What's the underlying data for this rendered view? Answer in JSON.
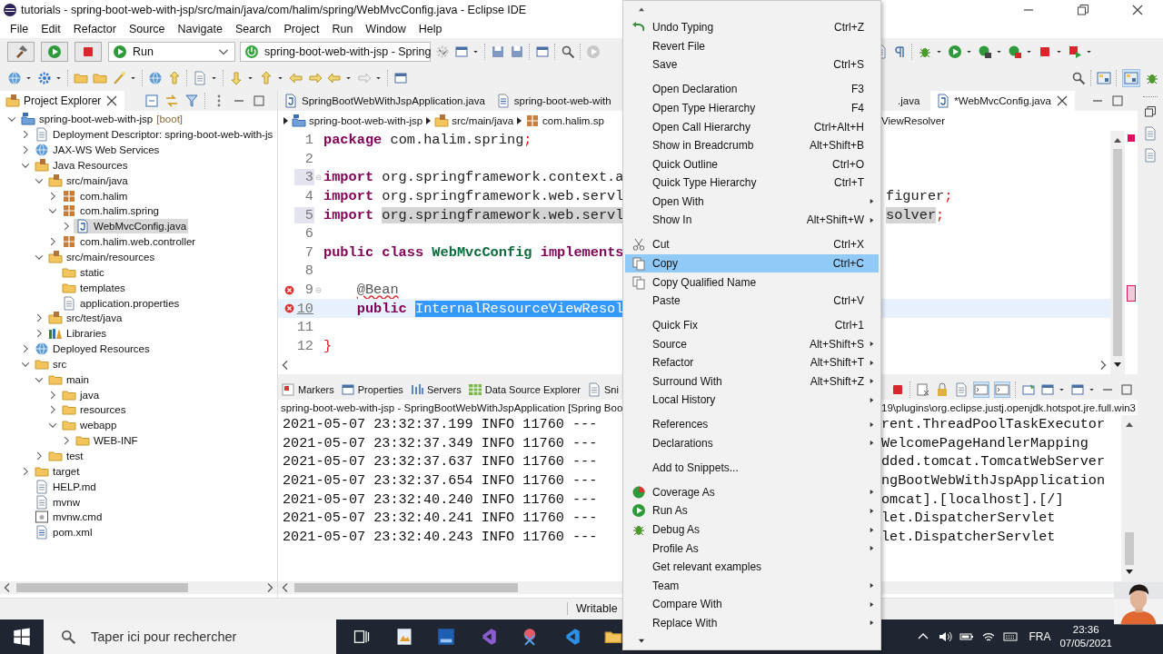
{
  "window": {
    "title": "tutorials - spring-boot-web-with-jsp/src/main/java/com/halim/spring/WebMvcConfig.java - Eclipse IDE"
  },
  "menu_bar": [
    "File",
    "Edit",
    "Refactor",
    "Source",
    "Navigate",
    "Search",
    "Project",
    "Run",
    "Window",
    "Help"
  ],
  "toolbar": {
    "run_combo": "Run",
    "launch_combo": "spring-boot-web-with-jsp - Spring"
  },
  "project_explorer": {
    "title": "Project Explorer",
    "tree": [
      {
        "label": "spring-boot-web-with-jsp",
        "tag": "[boot]",
        "kind": "project",
        "expanded": true,
        "selected": false,
        "children": [
          {
            "label": "Deployment Descriptor: spring-boot-web-with-js",
            "kind": "descriptor",
            "expanded": false,
            "selected": false
          },
          {
            "label": "JAX-WS Web Services",
            "kind": "services",
            "expanded": false,
            "selected": false
          },
          {
            "label": "Java Resources",
            "kind": "resources",
            "expanded": true,
            "selected": false,
            "children": [
              {
                "label": "src/main/java",
                "kind": "source-folder",
                "expanded": true,
                "selected": false,
                "children": [
                  {
                    "label": "com.halim",
                    "kind": "package",
                    "expanded": false,
                    "selected": false
                  },
                  {
                    "label": "com.halim.spring",
                    "kind": "package",
                    "expanded": true,
                    "selected": false,
                    "children": [
                      {
                        "label": "WebMvcConfig.java",
                        "kind": "java",
                        "expanded": false,
                        "selected": true
                      }
                    ]
                  },
                  {
                    "label": "com.halim.web.controller",
                    "kind": "package",
                    "expanded": false,
                    "selected": false
                  }
                ]
              },
              {
                "label": "src/main/resources",
                "kind": "source-folder",
                "expanded": true,
                "selected": false,
                "children": [
                  {
                    "label": "static",
                    "kind": "folder",
                    "selected": false
                  },
                  {
                    "label": "templates",
                    "kind": "folder",
                    "selected": false
                  },
                  {
                    "label": "application.properties",
                    "kind": "properties",
                    "selected": false
                  }
                ]
              },
              {
                "label": "src/test/java",
                "kind": "source-folder",
                "expanded": false,
                "selected": false
              },
              {
                "label": "Libraries",
                "kind": "library",
                "expanded": false,
                "selected": false
              }
            ]
          },
          {
            "label": "Deployed Resources",
            "kind": "deployed",
            "expanded": false,
            "selected": false
          },
          {
            "label": "src",
            "kind": "folder",
            "expanded": true,
            "selected": false,
            "children": [
              {
                "label": "main",
                "kind": "folder",
                "expanded": true,
                "selected": false,
                "children": [
                  {
                    "label": "java",
                    "kind": "folder",
                    "expanded": false,
                    "selected": false
                  },
                  {
                    "label": "resources",
                    "kind": "folder",
                    "expanded": false,
                    "selected": false
                  },
                  {
                    "label": "webapp",
                    "kind": "folder",
                    "expanded": true,
                    "selected": false,
                    "children": [
                      {
                        "label": "WEB-INF",
                        "kind": "folder",
                        "expanded": false,
                        "selected": false
                      }
                    ]
                  }
                ]
              },
              {
                "label": "test",
                "kind": "folder",
                "expanded": false,
                "selected": false
              }
            ]
          },
          {
            "label": "target",
            "kind": "folder",
            "expanded": false,
            "selected": false
          },
          {
            "label": "HELP.md",
            "kind": "document",
            "selected": false
          },
          {
            "label": "mvnw",
            "kind": "text",
            "selected": false
          },
          {
            "label": "mvnw.cmd",
            "kind": "command",
            "selected": false
          },
          {
            "label": "pom.xml",
            "kind": "xml",
            "selected": false
          }
        ]
      }
    ]
  },
  "editor": {
    "tabs": [
      {
        "label": "SpringBootWebWithJspApplication.java",
        "selected": false
      },
      {
        "label": "spring-boot-web-with",
        "selected": false
      }
    ],
    "tabs_past_menu": [
      {
        "label": ".java",
        "selected": false,
        "closable": false
      },
      {
        "label": "*WebMvcConfig.java",
        "selected": true,
        "closable": true
      }
    ],
    "breadcrumb": [
      "spring-boot-web-with-jsp",
      "src/main/java",
      "com.halim.sp"
    ],
    "breadcrumb_past_menu": "ViewResolver",
    "lines": [
      {
        "number": "1",
        "error": false,
        "fold": false,
        "marked": false,
        "current": false,
        "tokens": [
          {
            "text": "package",
            "kind": "keyword"
          },
          {
            "text": " com.halim.spring",
            "kind": "plain"
          },
          {
            "text": ";",
            "kind": "punct"
          }
        ]
      },
      {
        "number": "2",
        "error": false,
        "fold": false,
        "marked": false,
        "current": false
      },
      {
        "number": "3",
        "error": false,
        "fold": true,
        "marked": true,
        "current": false,
        "tokens": [
          {
            "text": "import",
            "kind": "keyword"
          },
          {
            "text": " org.springframework.context.a",
            "kind": "plain"
          }
        ]
      },
      {
        "number": "4",
        "error": false,
        "fold": false,
        "marked": false,
        "current": false,
        "tokens": [
          {
            "text": "import",
            "kind": "keyword"
          },
          {
            "text": " org.springframework.web.servl",
            "kind": "plain"
          }
        ],
        "after": [
          {
            "text": "figurer",
            "kind": "plain"
          },
          {
            "text": ";",
            "kind": "punct"
          }
        ]
      },
      {
        "number": "5",
        "error": false,
        "fold": false,
        "marked": true,
        "current": false,
        "tokens": [
          {
            "text": "import",
            "kind": "keyword"
          },
          {
            "text": " org.springframework.web.servl",
            "kind": "occurrence"
          }
        ],
        "after": [
          {
            "text": "solver",
            "kind": "occurrence"
          },
          {
            "text": ";",
            "kind": "punct"
          }
        ]
      },
      {
        "number": "6",
        "error": false,
        "fold": false,
        "marked": false,
        "current": false
      },
      {
        "number": "7",
        "error": false,
        "fold": false,
        "marked": false,
        "current": false,
        "tokens": [
          {
            "text": "public",
            "kind": "keyword"
          },
          {
            "text": " class",
            "kind": "keyword"
          },
          {
            "text": " WebMvcConfig",
            "kind": "type"
          },
          {
            "text": " implements",
            "kind": "keyword"
          }
        ]
      },
      {
        "number": "8",
        "error": false,
        "fold": false,
        "marked": false,
        "current": false
      },
      {
        "number": "9",
        "error": true,
        "fold": true,
        "marked": false,
        "current": false,
        "tokens": [
          {
            "text": "    @Bean",
            "kind": "annotation"
          }
        ]
      },
      {
        "number": "10",
        "error": true,
        "fold": false,
        "marked": false,
        "current": true,
        "tokens": [
          {
            "text": "    public",
            "kind": "keyword"
          },
          {
            "text": " InternalResourceViewResol",
            "kind": "selection"
          }
        ]
      },
      {
        "number": "11",
        "error": false,
        "fold": false,
        "marked": false,
        "current": false
      },
      {
        "number": "12",
        "error": false,
        "fold": false,
        "marked": false,
        "current": false,
        "tokens": [
          {
            "text": "}",
            "kind": "punct"
          }
        ]
      }
    ]
  },
  "console": {
    "tabs": [
      {
        "label": "Markers",
        "kind": "markers"
      },
      {
        "label": "Properties",
        "kind": "properties"
      },
      {
        "label": "Servers",
        "kind": "servers"
      },
      {
        "label": "Data Source Explorer",
        "kind": "datasource"
      },
      {
        "label": "Sni",
        "kind": "snippets"
      }
    ],
    "header": "spring-boot-web-with-jsp - SpringBootWebWithJspApplication [Spring Boo",
    "header_past_menu": "19\\plugins\\org.eclipse.justj.openjdk.hotspot.jre.full.win3",
    "lines": [
      {
        "text": "2021-05-07 23:32:37.199  INFO 11760 ---",
        "after": "rent.ThreadPoolTaskExecutor"
      },
      {
        "text": "2021-05-07 23:32:37.349  INFO 11760 ---",
        "after": "WelcomePageHandlerMapping"
      },
      {
        "text": "2021-05-07 23:32:37.637  INFO 11760 ---",
        "after": "dded.tomcat.TomcatWebServer"
      },
      {
        "text": "2021-05-07 23:32:37.654  INFO 11760 ---",
        "after": "ngBootWebWithJspApplication"
      },
      {
        "text": "2021-05-07 23:32:40.240  INFO 11760 ---",
        "after": "omcat].[localhost].[/]"
      },
      {
        "text": "2021-05-07 23:32:40.241  INFO 11760 ---",
        "after": "let.DispatcherServlet"
      },
      {
        "text": "2021-05-07 23:32:40.243  INFO 11760 ---",
        "after": "let.DispatcherServlet"
      }
    ]
  },
  "status_bar": {
    "mode": "Writable"
  },
  "context_menu": [
    {
      "kind": "item",
      "label": "Undo Typing",
      "shortcut": "Ctrl+Z",
      "submenu": false,
      "selected": false
    },
    {
      "kind": "item",
      "label": "Revert File",
      "submenu": false,
      "selected": false
    },
    {
      "kind": "item",
      "label": "Save",
      "shortcut": "Ctrl+S",
      "submenu": false,
      "selected": false
    },
    {
      "kind": "separator"
    },
    {
      "kind": "item",
      "label": "Open Declaration",
      "shortcut": "F3",
      "submenu": false,
      "selected": false
    },
    {
      "kind": "item",
      "label": "Open Type Hierarchy",
      "shortcut": "F4",
      "submenu": false,
      "selected": false
    },
    {
      "kind": "item",
      "label": "Open Call Hierarchy",
      "shortcut": "Ctrl+Alt+H",
      "submenu": false,
      "selected": false
    },
    {
      "kind": "item",
      "label": "Show in Breadcrumb",
      "shortcut": "Alt+Shift+B",
      "submenu": false,
      "selected": false
    },
    {
      "kind": "item",
      "label": "Quick Outline",
      "shortcut": "Ctrl+O",
      "submenu": false,
      "selected": false
    },
    {
      "kind": "item",
      "label": "Quick Type Hierarchy",
      "shortcut": "Ctrl+T",
      "submenu": false,
      "selected": false
    },
    {
      "kind": "item",
      "label": "Open With",
      "submenu": true,
      "selected": false
    },
    {
      "kind": "item",
      "label": "Show In",
      "shortcut": "Alt+Shift+W",
      "submenu": true,
      "selected": false
    },
    {
      "kind": "separator"
    },
    {
      "kind": "item",
      "label": "Cut",
      "shortcut": "Ctrl+X",
      "submenu": false,
      "selected": false
    },
    {
      "kind": "item",
      "label": "Copy",
      "shortcut": "Ctrl+C",
      "submenu": false,
      "selected": true
    },
    {
      "kind": "item",
      "label": "Copy Qualified Name",
      "submenu": false,
      "selected": false
    },
    {
      "kind": "item",
      "label": "Paste",
      "shortcut": "Ctrl+V",
      "submenu": false,
      "selected": false
    },
    {
      "kind": "separator"
    },
    {
      "kind": "item",
      "label": "Quick Fix",
      "shortcut": "Ctrl+1",
      "submenu": false,
      "selected": false
    },
    {
      "kind": "item",
      "label": "Source",
      "shortcut": "Alt+Shift+S",
      "submenu": true,
      "selected": false
    },
    {
      "kind": "item",
      "label": "Refactor",
      "shortcut": "Alt+Shift+T",
      "submenu": true,
      "selected": false
    },
    {
      "kind": "item",
      "label": "Surround With",
      "shortcut": "Alt+Shift+Z",
      "submenu": true,
      "selected": false
    },
    {
      "kind": "item",
      "label": "Local History",
      "submenu": true,
      "selected": false
    },
    {
      "kind": "separator"
    },
    {
      "kind": "item",
      "label": "References",
      "submenu": true,
      "selected": false
    },
    {
      "kind": "item",
      "label": "Declarations",
      "submenu": true,
      "selected": false
    },
    {
      "kind": "separator"
    },
    {
      "kind": "item",
      "label": "Add to Snippets...",
      "submenu": false,
      "selected": false
    },
    {
      "kind": "separator"
    },
    {
      "kind": "item",
      "label": "Coverage As",
      "submenu": true,
      "selected": false
    },
    {
      "kind": "item",
      "label": "Run As",
      "submenu": true,
      "selected": false
    },
    {
      "kind": "item",
      "label": "Debug As",
      "submenu": true,
      "selected": false
    },
    {
      "kind": "item",
      "label": "Profile As",
      "submenu": true,
      "selected": false
    },
    {
      "kind": "item",
      "label": "Get relevant examples",
      "submenu": false,
      "selected": false
    },
    {
      "kind": "item",
      "label": "Team",
      "submenu": true,
      "selected": false
    },
    {
      "kind": "item",
      "label": "Compare With",
      "submenu": true,
      "selected": false
    },
    {
      "kind": "item",
      "label": "Replace With",
      "submenu": true,
      "selected": false
    }
  ],
  "taskbar": {
    "search_placeholder": "Taper ici pour rechercher",
    "language": "FRA",
    "time": "23:36",
    "date": "07/05/2021"
  }
}
